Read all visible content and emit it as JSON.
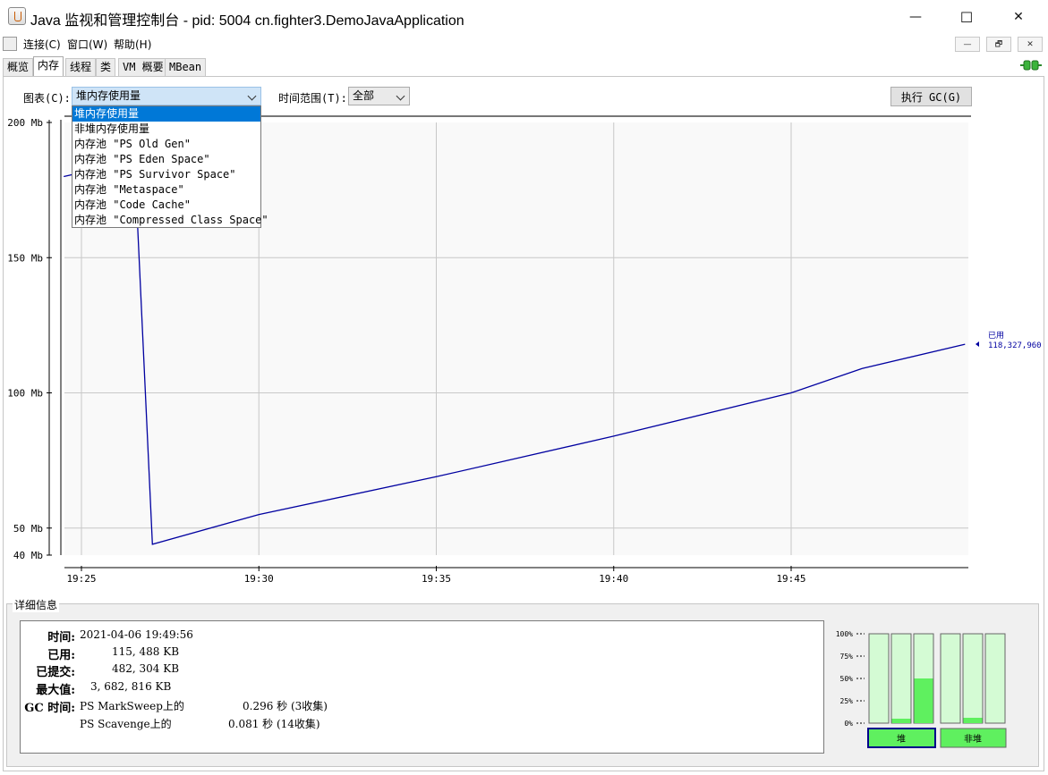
{
  "window": {
    "title": "Java 监视和管理控制台 - pid: 5004 cn.fighter3.DemoJavaApplication",
    "minimize": "—",
    "maximize": "☐",
    "close": "✕"
  },
  "menu": {
    "items": [
      "连接(C)",
      "窗口(W)",
      "帮助(H)"
    ],
    "mdi": [
      "—",
      "🗗",
      "✕"
    ]
  },
  "tabs": [
    "概览",
    "内存",
    "线程",
    "类",
    "VM 概要",
    "MBean"
  ],
  "controls": {
    "chart_label": "图表(C):",
    "chart_selected": "堆内存使用量",
    "range_label": "时间范围(T):",
    "range_selected": "全部",
    "gc_button": "执行 GC(G)"
  },
  "dropdown": {
    "options": [
      "堆内存使用量",
      "非堆内存使用量",
      "内存池 \"PS Old Gen\"",
      "内存池 \"PS Eden Space\"",
      "内存池 \"PS Survivor Space\"",
      "内存池 \"Metaspace\"",
      "内存池 \"Code Cache\"",
      "内存池 \"Compressed Class Space\""
    ]
  },
  "chart_data": {
    "type": "line",
    "series": [
      {
        "name": "已用",
        "current_label": "118,327,960",
        "color": "#0000a0",
        "x": [
          "19:24.5",
          "19:26.2",
          "19:26.5",
          "19:27",
          "19:30",
          "19:35",
          "19:40",
          "19:45",
          "19:47",
          "19:49.9"
        ],
        "y": [
          180,
          185,
          185,
          44,
          55,
          69,
          84,
          100,
          109,
          118
        ]
      }
    ],
    "x_ticks": [
      "19:25",
      "19:30",
      "19:35",
      "19:40",
      "19:45"
    ],
    "y_ticks": [
      "40 Mb",
      "50 Mb",
      "100 Mb",
      "150 Mb",
      "200 Mb"
    ],
    "ylim": [
      40,
      200
    ],
    "grid": true
  },
  "details": {
    "legend": "详细信息",
    "rows": [
      {
        "key": "时间:",
        "value": "2021-04-06 19:49:56"
      },
      {
        "key": "已用:",
        "value": "115, 488 KB"
      },
      {
        "key": "已提交:",
        "value": "482, 304 KB"
      },
      {
        "key": "最大值:",
        "value": "3, 682, 816 KB"
      },
      {
        "key": "GC 时间:",
        "value": "PS MarkSweep上的",
        "extra": "0.296 秒 (3收集)"
      }
    ],
    "gc2": {
      "value": "PS Scavenge上的",
      "extra": "0.081 秒 (14收集)"
    }
  },
  "bars": {
    "y_ticks": [
      "100%",
      "75%",
      "50%",
      "25%",
      "0%"
    ],
    "heap_label": "堆",
    "nonheap_label": "非堆",
    "heap_fill": [
      0,
      5,
      50
    ],
    "nonheap_fill": [
      0,
      6,
      0
    ],
    "color_fill": "#5ff05f",
    "color_bg": "#d4fbd4"
  }
}
